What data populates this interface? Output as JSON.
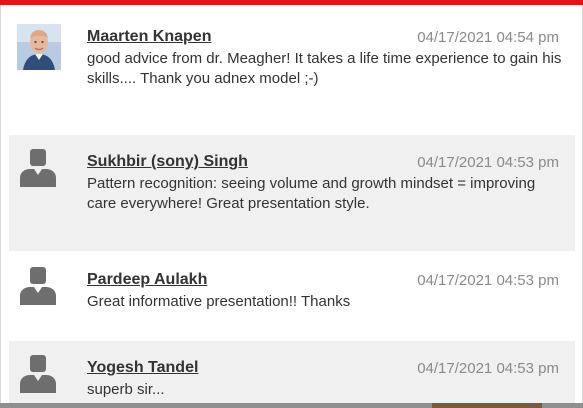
{
  "comments": [
    {
      "author": "Maarten Knapen",
      "timestamp": "04/17/2021 04:54 pm",
      "text": "good advice from dr. Meagher! It takes a life time experience to gain his skills.... Thank you adnex model ;-)",
      "avatar": "user-photo-avatar"
    },
    {
      "author": "Sukhbir (sony) Singh",
      "timestamp": "04/17/2021 04:53 pm",
      "text": "Pattern recognition: seeing volume and growth mindset = improving care everywhere! Great presentation style.",
      "avatar": "default-user-icon"
    },
    {
      "author": "Pardeep Aulakh",
      "timestamp": "04/17/2021 04:53 pm",
      "text": "Great informative presentation!! Thanks",
      "avatar": "default-user-icon"
    },
    {
      "author": "Yogesh Tandel",
      "timestamp": "04/17/2021 04:53 pm",
      "text": "superb sir...",
      "avatar": "default-user-icon"
    }
  ],
  "colors": {
    "accent_bar": "#e3151b",
    "alt_row": "#f0f0f0",
    "text": "#333333",
    "timestamp": "#8a8a8a",
    "avatar_silhouette": "#6e6e6e"
  }
}
